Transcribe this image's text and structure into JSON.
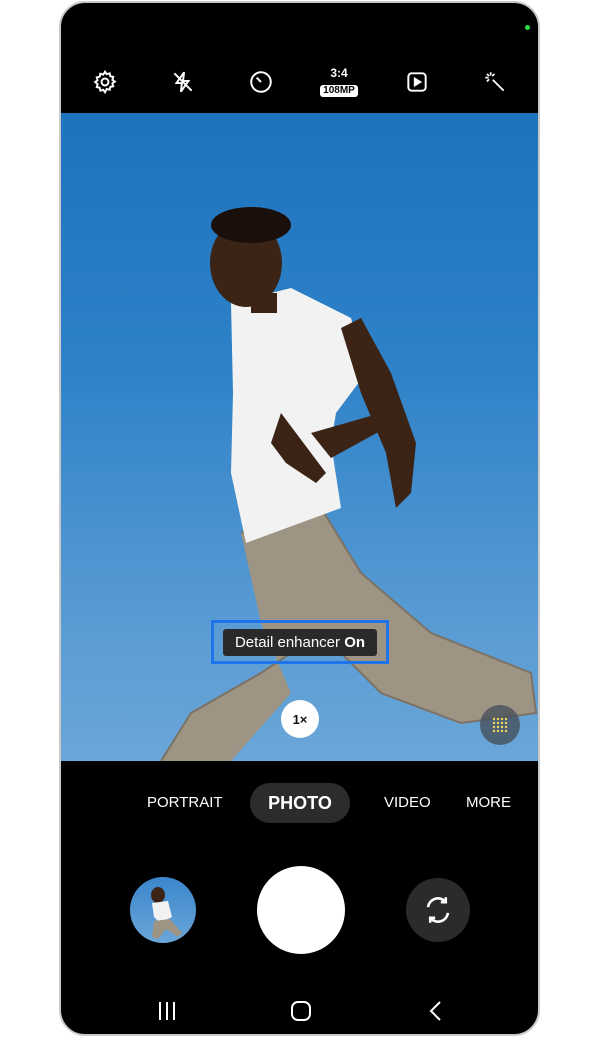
{
  "top_toolbar": {
    "icons": [
      "settings-icon",
      "flash-off-icon",
      "timer-icon",
      "aspect-ratio-icon",
      "motion-photo-icon",
      "effects-icon"
    ],
    "ratio_label": "3:4",
    "resolution_label": "108MP"
  },
  "viewfinder": {
    "tooltip": {
      "text": "Detail enhancer ",
      "state": "On"
    },
    "zoom_label": "1×"
  },
  "modes": {
    "items": [
      "PORTRAIT",
      "PHOTO",
      "VIDEO",
      "MORE"
    ],
    "active": "PHOTO"
  },
  "colors": {
    "sky": "#2f82c8",
    "highlight_border": "#1e74e8",
    "status_dot": "#2fdc4a"
  }
}
